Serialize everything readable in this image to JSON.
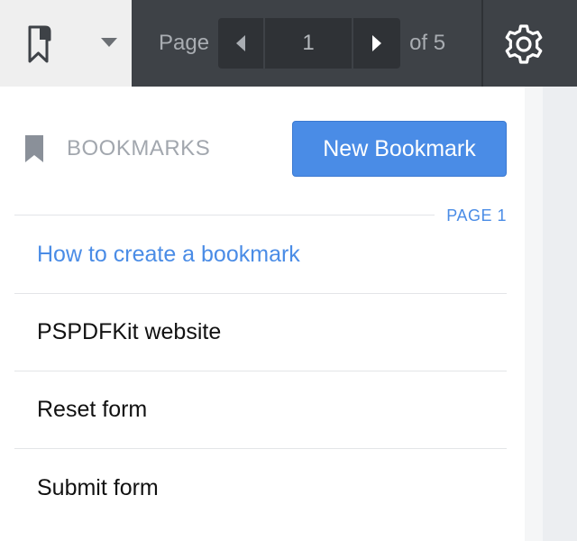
{
  "toolbar": {
    "page_label": "Page",
    "current_page": "1",
    "of_label": "of 5",
    "colors": {
      "bar": "#3e4247",
      "segment": "#2f3236"
    },
    "icons": {
      "sidebar": "bookmark-icon",
      "dropdown": "caret-down-icon",
      "prev": "triangle-left-icon",
      "next": "triangle-right-icon",
      "settings": "gear-icon"
    }
  },
  "sidebar": {
    "title": "BOOKMARKS",
    "new_button": "New Bookmark",
    "page_tag": "PAGE 1",
    "accent": "#4a8ce6",
    "bookmarks": [
      {
        "label": "How to create a bookmark"
      },
      {
        "label": "PSPDFKit website"
      },
      {
        "label": "Reset form"
      },
      {
        "label": "Submit form"
      }
    ]
  }
}
